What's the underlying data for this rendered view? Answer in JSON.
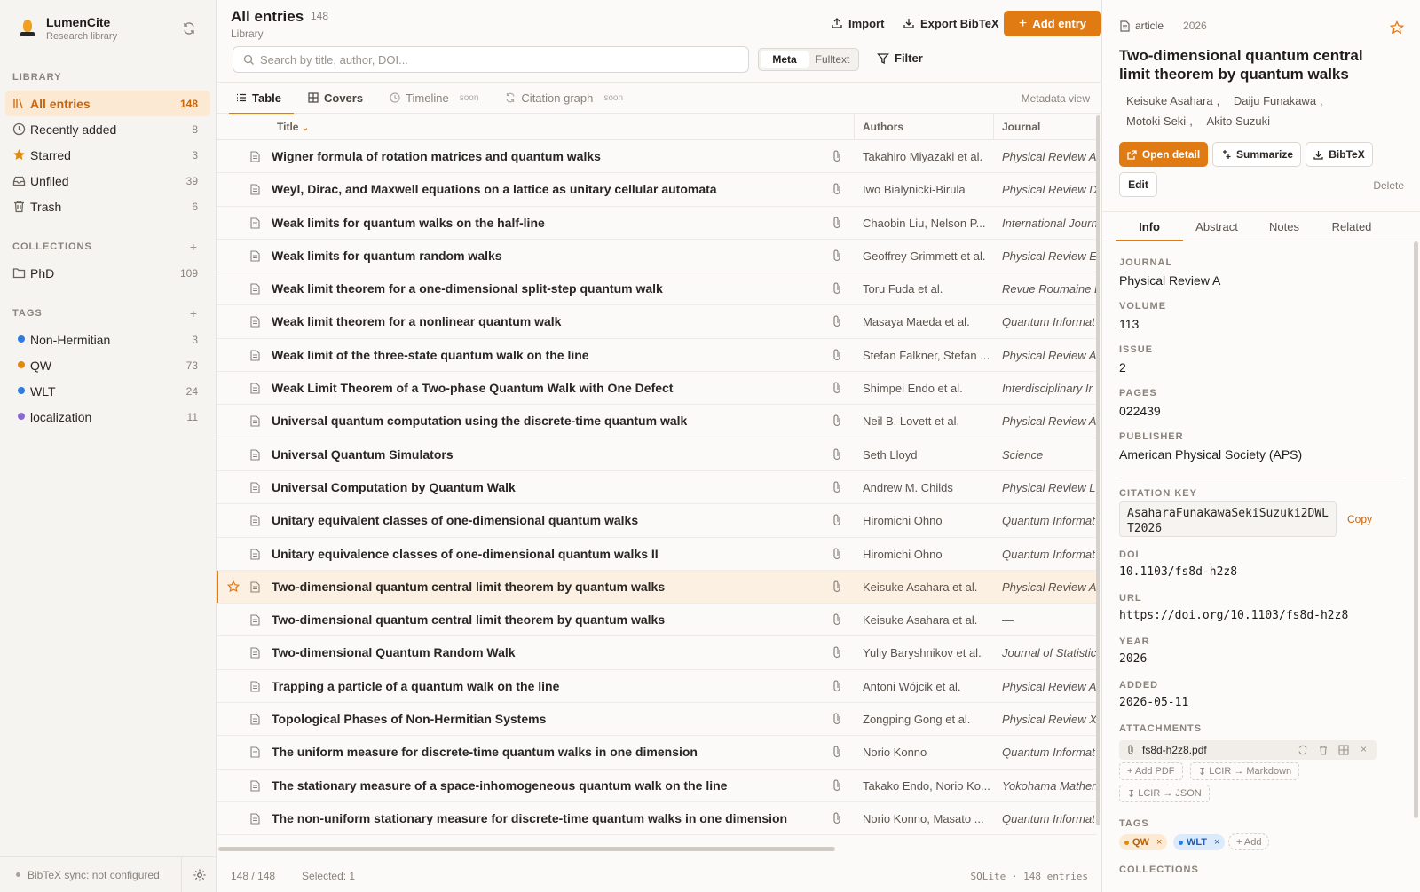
{
  "app": {
    "name": "LumenCite",
    "subtitle": "Research library"
  },
  "sidebar": {
    "library_title": "LIBRARY",
    "library_items": [
      {
        "label": "All entries",
        "count": "148",
        "icon": "library-icon",
        "active": true
      },
      {
        "label": "Recently added",
        "count": "8",
        "icon": "clock-icon"
      },
      {
        "label": "Starred",
        "count": "3",
        "icon": "star-icon"
      },
      {
        "label": "Unfiled",
        "count": "39",
        "icon": "inbox-icon"
      },
      {
        "label": "Trash",
        "count": "6",
        "icon": "trash-icon"
      }
    ],
    "collections_title": "COLLECTIONS",
    "collections": [
      {
        "label": "PhD",
        "count": "109",
        "icon": "folder-icon"
      }
    ],
    "tags_title": "TAGS",
    "tags": [
      {
        "label": "Non-Hermitian",
        "count": "3",
        "color": "#2f7be0"
      },
      {
        "label": "QW",
        "count": "73",
        "color": "#e08a12"
      },
      {
        "label": "WLT",
        "count": "24",
        "color": "#2f7be0"
      },
      {
        "label": "localization",
        "count": "11",
        "color": "#8a6ad0"
      }
    ],
    "add_symbol": "+",
    "footer": "BibTeX sync: not configured"
  },
  "main": {
    "title": "All entries",
    "count": "148",
    "subtitle": "Library",
    "import_label": "Import",
    "export_label": "Export BibTeX",
    "add_label": "Add entry",
    "search_placeholder": "Search by title, author, DOI...",
    "mode_meta": "Meta",
    "mode_fulltext": "Fulltext",
    "filter_label": "Filter",
    "tabs": [
      {
        "label": "Table",
        "icon": "list-icon"
      },
      {
        "label": "Covers",
        "icon": "grid-icon"
      },
      {
        "label": "Timeline",
        "icon": "clock-icon",
        "badge": "soon"
      },
      {
        "label": "Citation graph",
        "icon": "refresh-icon",
        "badge": "soon"
      }
    ],
    "metadata_view": "Metadata view",
    "columns": {
      "title": "Title",
      "authors": "Authors",
      "journal": "Journal"
    },
    "rows": [
      {
        "title": "Wigner formula of rotation matrices and quantum walks",
        "authors": "Takahiro Miyazaki et al.",
        "journal": "Physical Review A"
      },
      {
        "title": "Weyl, Dirac, and Maxwell equations on a lattice as unitary cellular automata",
        "authors": "Iwo Bialynicki-Birula",
        "journal": "Physical Review D"
      },
      {
        "title": "Weak limits for quantum walks on the half-line",
        "authors": "Chaobin Liu, Nelson P...",
        "journal": "International Journ"
      },
      {
        "title": "Weak limits for quantum random walks",
        "authors": "Geoffrey Grimmett et al.",
        "journal": "Physical Review E"
      },
      {
        "title": "Weak limit theorem for a one-dimensional split-step quantum walk",
        "authors": "Toru Fuda et al.",
        "journal": "Revue Roumaine D"
      },
      {
        "title": "Weak limit theorem for a nonlinear quantum walk",
        "authors": "Masaya Maeda et al.",
        "journal": "Quantum Informat"
      },
      {
        "title": "Weak limit of the three-state quantum walk on the line",
        "authors": "Stefan Falkner, Stefan ...",
        "journal": "Physical Review A"
      },
      {
        "title": "Weak Limit Theorem of a Two-phase Quantum Walk with One Defect",
        "authors": "Shimpei Endo et al.",
        "journal": "Interdisciplinary Ir"
      },
      {
        "title": "Universal quantum computation using the discrete-time quantum walk",
        "authors": "Neil B. Lovett et al.",
        "journal": "Physical Review A"
      },
      {
        "title": "Universal Quantum Simulators",
        "authors": "Seth Lloyd",
        "journal": "Science"
      },
      {
        "title": "Universal Computation by Quantum Walk",
        "authors": "Andrew M. Childs",
        "journal": "Physical Review Le"
      },
      {
        "title": "Unitary equivalent classes of one-dimensional quantum walks",
        "authors": "Hiromichi Ohno",
        "journal": "Quantum Informat"
      },
      {
        "title": "Unitary equivalence classes of one-dimensional quantum walks II",
        "authors": "Hiromichi Ohno",
        "journal": "Quantum Informat"
      },
      {
        "title": "Two-dimensional quantum central limit theorem by quantum walks",
        "authors": "Keisuke Asahara et al.",
        "journal": "Physical Review A",
        "selected": true
      },
      {
        "title": "Two-dimensional quantum central limit theorem by quantum walks",
        "authors": "Keisuke Asahara et al.",
        "journal": "—"
      },
      {
        "title": "Two-dimensional Quantum Random Walk",
        "authors": "Yuliy Baryshnikov et al.",
        "journal": "Journal of Statistic"
      },
      {
        "title": "Trapping a particle of a quantum walk on the line",
        "authors": "Antoni Wójcik et al.",
        "journal": "Physical Review A"
      },
      {
        "title": "Topological Phases of Non-Hermitian Systems",
        "authors": "Zongping Gong et al.",
        "journal": "Physical Review X"
      },
      {
        "title": "The uniform measure for discrete-time quantum walks in one dimension",
        "authors": "Norio Konno",
        "journal": "Quantum Informat"
      },
      {
        "title": "The stationary measure of a space-inhomogeneous quantum walk on the line",
        "authors": "Takako Endo, Norio Ko...",
        "journal": "Yokohama Mathen"
      },
      {
        "title": "The non-uniform stationary measure for discrete-time quantum walks in one dimension",
        "authors": "Norio Konno, Masato ...",
        "journal": "Quantum Informat"
      }
    ],
    "footer_range": "148 / 148",
    "footer_selected": "Selected: 1",
    "footer_db": "SQLite · 148 entries"
  },
  "detail": {
    "type": "article",
    "year": "2026",
    "title": "Two-dimensional quantum central limit theorem by quantum walks",
    "authors": [
      "Keisuke Asahara",
      "Daiju Funakawa",
      "Motoki Seki",
      "Akito Suzuki"
    ],
    "author_sep": ",",
    "open_label": "Open detail",
    "summarize_label": "Summarize",
    "bibtex_label": "BibTeX",
    "edit_label": "Edit",
    "delete_label": "Delete",
    "tabs": [
      "Info",
      "Abstract",
      "Notes",
      "Related"
    ],
    "fields": {
      "journal_label": "JOURNAL",
      "journal": "Physical Review A",
      "volume_label": "VOLUME",
      "volume": "113",
      "issue_label": "ISSUE",
      "issue": "2",
      "pages_label": "PAGES",
      "pages": "022439",
      "publisher_label": "PUBLISHER",
      "publisher": "American Physical Society (APS)",
      "citekey_label": "CITATION KEY",
      "citekey": "AsaharaFunakawaSekiSuzuki2DWLT2026",
      "copy_label": "Copy",
      "doi_label": "DOI",
      "doi": "10.1103/fs8d-h2z8",
      "url_label": "URL",
      "url": "https://doi.org/10.1103/fs8d-h2z8",
      "year_label": "YEAR",
      "year": "2026",
      "added_label": "ADDED",
      "added": "2026-05-11",
      "attachments_label": "ATTACHMENTS",
      "attachment": "fs8d-h2z8.pdf",
      "add_pdf": "+ Add PDF",
      "lcir_md": "LCIR → Markdown",
      "lcir_json": "LCIR → JSON",
      "tags_label": "TAGS",
      "tag1": "QW",
      "tag2": "WLT",
      "tag_add": "+ Add",
      "collections_label": "COLLECTIONS"
    }
  },
  "colors": {
    "accent": "#e07a12",
    "selected_row": "#fcf0e3"
  }
}
